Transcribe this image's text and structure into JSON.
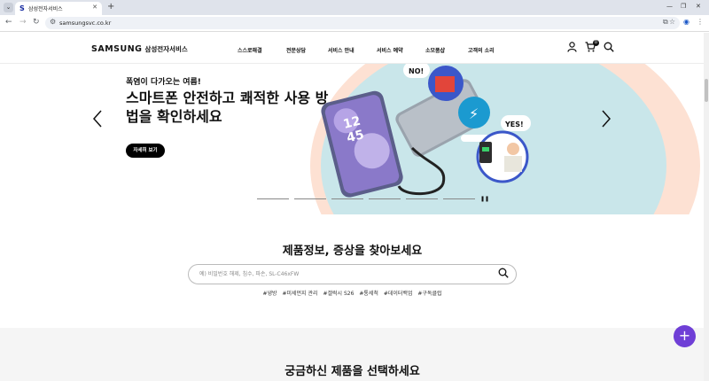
{
  "browser": {
    "tab_title": "삼성전자서비스",
    "tab_favicon": "S",
    "url": "samsungsvc.co.kr",
    "icons": [
      "tab-list-icon",
      "close-icon",
      "new-tab-icon",
      "minimize-icon",
      "maximize-icon",
      "window-close-icon",
      "back-icon",
      "forward-icon",
      "reload-icon",
      "site-info-icon",
      "bookmark-star-icon",
      "extensions-icon",
      "profile-icon",
      "menu-icon"
    ]
  },
  "header": {
    "logo": "SAMSUNG",
    "logo_sub": "삼성전자서비스",
    "nav": [
      "스스로해결",
      "전문상담",
      "서비스 안내",
      "서비스 예약",
      "소모품샵",
      "고객의 소리"
    ],
    "cart_count": "0"
  },
  "hero": {
    "subtitle": "폭염이 다가오는 여름!",
    "title": "스마트폰 안전하고 쾌적한 사용 방법을 확인하세요",
    "button": "자세히 보기",
    "img_labels": [
      "NO!",
      "YES!"
    ],
    "phone_clock_hour": "12",
    "phone_clock_min": "45",
    "slides_count": 6
  },
  "search": {
    "title": "제품정보, 증상을 찾아보세요",
    "placeholder": "예) 비밀번호 해제, 침수, 파손, SL-C46xFW",
    "tags": [
      "#냉방",
      "#미세먼지 관리",
      "#갤럭시 S26",
      "#통세척",
      "#데이터백업",
      "#구독클럽"
    ]
  },
  "lower": {
    "title": "궁금하신 제품을 선택하세요"
  },
  "fab": {
    "label": "+"
  },
  "colors": {
    "brand": "#1428a0",
    "fab": "#6f3fd6",
    "hero_peach": "#fde1d3",
    "hero_teal": "#c9e6ea"
  }
}
